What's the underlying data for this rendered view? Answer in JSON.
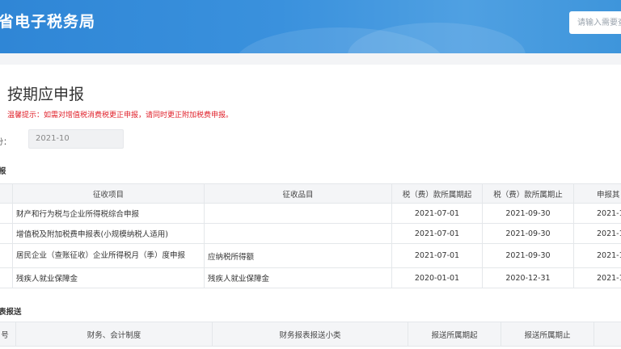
{
  "header": {
    "title": "省电子税务局",
    "search_placeholder": "请输入需要查"
  },
  "page": {
    "title": "按期应申报",
    "tip": "温馨提示：如需对增值税消费税更正申报，请同时更正附加税费申报。",
    "period_label": "份：",
    "period_value": "2021-10"
  },
  "declare_section": {
    "label": "报",
    "headers": [
      "",
      "征收项目",
      "征收品目",
      "税（费）款所属期起",
      "税（费）款所属期止",
      "申报其"
    ],
    "rows": [
      {
        "item": "财产和行为税与企业所得税综合申报",
        "category": "",
        "start": "2021-07-01",
        "end": "2021-09-30",
        "deadline": "2021-1"
      },
      {
        "item": "增值税及附加税费申报表(小规模纳税人适用)",
        "category": "",
        "start": "2021-07-01",
        "end": "2021-09-30",
        "deadline": "2021-1"
      },
      {
        "item": "居民企业（查账征收）企业所得税月（季）度申报",
        "category": "应纳税所得额",
        "start": "2021-07-01",
        "end": "2021-09-30",
        "deadline": "2021-1"
      },
      {
        "item": "残疾人就业保障金",
        "category": "残疾人就业保障金",
        "start": "2020-01-01",
        "end": "2020-12-31",
        "deadline": "2021-1"
      }
    ]
  },
  "report_section": {
    "label": "表报送",
    "headers": [
      "号",
      "财务、会计制度",
      "财务报表报送小类",
      "报送所属期起",
      "报送所属期止",
      ""
    ]
  },
  "colors": {
    "header_blue": "#3a8fdc",
    "tip_red": "#e0202a",
    "table_header_bg": "#f4f5f7"
  }
}
